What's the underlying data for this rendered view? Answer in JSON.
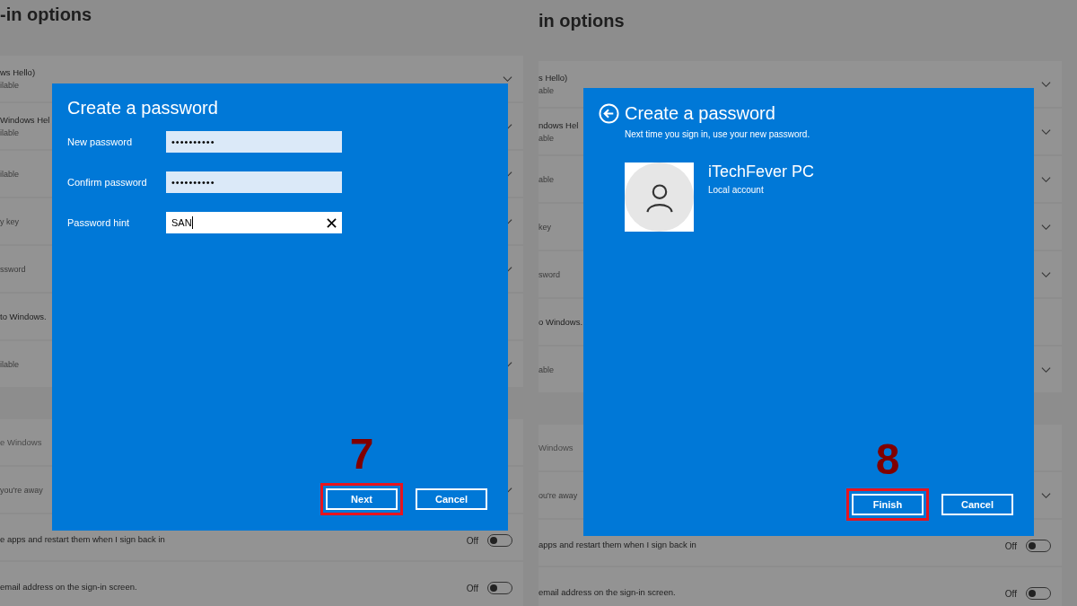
{
  "panels": [
    {
      "page_title": "-in options",
      "rows": [
        {
          "kind": "expander",
          "title": "ws Hello)",
          "subtitle": "ilable"
        },
        {
          "kind": "expander",
          "title": "Windows Hel",
          "subtitle": "ilable"
        },
        {
          "kind": "expander",
          "subtitle": "ilable"
        },
        {
          "kind": "expander",
          "subtitle": "y key"
        },
        {
          "kind": "expander",
          "subtitle": "ssword"
        },
        {
          "kind": "plain",
          "title": "to Windows."
        },
        {
          "kind": "expander",
          "subtitle": "ilable"
        },
        {
          "kind": "gap"
        },
        {
          "kind": "plain",
          "title": "e Windows",
          "disabled": true
        },
        {
          "kind": "expander",
          "subtitle": "you're away"
        },
        {
          "kind": "toggle",
          "title": "e apps and restart them when I sign back in",
          "state": "Off",
          "on": false
        },
        {
          "kind": "toggle",
          "title": "email address on the sign-in screen.",
          "state": "Off",
          "on": false
        }
      ],
      "dialog": {
        "kind": "form",
        "title": "Create a password",
        "fields": [
          {
            "label": "New password",
            "kind": "password",
            "value": "••••••••••"
          },
          {
            "label": "Confirm password",
            "kind": "password",
            "value": "••••••••••"
          },
          {
            "label": "Password hint",
            "kind": "text",
            "value": "SAN",
            "focused": true
          }
        ],
        "step": "7",
        "buttons": [
          {
            "label": "Next",
            "highlighted": true
          },
          {
            "label": "Cancel",
            "highlighted": false
          }
        ]
      }
    },
    {
      "page_title": "in options",
      "rows": [
        {
          "kind": "expander",
          "title": "s Hello)",
          "subtitle": "able"
        },
        {
          "kind": "expander",
          "title": "ndows Hel",
          "subtitle": "able"
        },
        {
          "kind": "expander",
          "subtitle": "able"
        },
        {
          "kind": "expander",
          "subtitle": "key"
        },
        {
          "kind": "expander",
          "subtitle": "sword"
        },
        {
          "kind": "plain",
          "title": "o Windows."
        },
        {
          "kind": "expander",
          "subtitle": "able"
        },
        {
          "kind": "gap"
        },
        {
          "kind": "plain",
          "title": "Windows",
          "disabled": true
        },
        {
          "kind": "expander",
          "subtitle": "ou're away"
        },
        {
          "kind": "toggle",
          "title": "apps and restart them when I sign back in",
          "state": "Off",
          "on": false
        },
        {
          "kind": "toggle",
          "title": "email address on the sign-in screen.",
          "state": "Off",
          "on": false
        }
      ],
      "dialog": {
        "kind": "account",
        "title": "Create a password",
        "back": true,
        "subtitle": "Next time you sign in, use your new password.",
        "account": {
          "name": "iTechFever PC",
          "type": "Local account"
        },
        "step": "8",
        "buttons": [
          {
            "label": "Finish",
            "highlighted": true
          },
          {
            "label": "Cancel",
            "highlighted": false
          }
        ]
      }
    }
  ]
}
